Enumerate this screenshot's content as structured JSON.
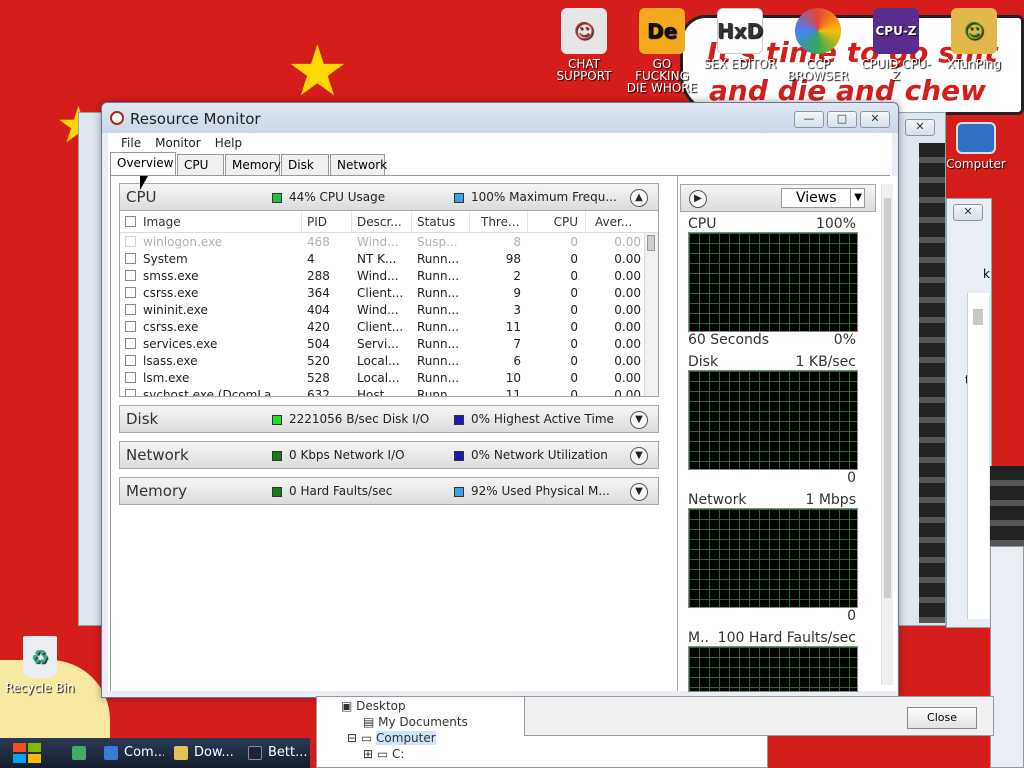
{
  "desktop": {
    "meme_text_1": "It's time to go shit",
    "meme_text_2": "and die and chew",
    "icons": [
      {
        "label": "CHAT SUPPORT",
        "color": "#f0f0f0"
      },
      {
        "label": "GO FUCKING DIE WHORE",
        "color": "#f4a81d"
      },
      {
        "label": "SEX EDITOR",
        "color": "#ffffff"
      },
      {
        "label": "CCP BROWSER",
        "color": "#ea4335"
      },
      {
        "label": "CPUID CPU-Z",
        "color": "#5a2d8c"
      },
      {
        "label": "XTunPing",
        "color": "#e2b84a"
      }
    ],
    "computer_icon_label": "Computer",
    "properties_fragment": "ties",
    "k_fragment": "k",
    "recycle_bin_label": "Recycle Bin"
  },
  "window": {
    "title": "Resource Monitor",
    "minimize": "—",
    "maximize": "□",
    "close": "✕"
  },
  "menu": [
    "File",
    "Monitor",
    "Help"
  ],
  "tabs": [
    "Overview",
    "CPU",
    "Memory",
    "Disk",
    "Network"
  ],
  "sections": {
    "cpu": {
      "title": "CPU",
      "stat1": "44% CPU Usage",
      "stat1_color": "#22c040",
      "stat2": "100% Maximum Frequ...",
      "stat2_color": "#3aa0e8"
    },
    "disk": {
      "title": "Disk",
      "stat1": "2221056 B/sec Disk I/O",
      "stat1_color": "#22dd22",
      "stat2": "0% Highest Active Time",
      "stat2_color": "#1a1ab0"
    },
    "network": {
      "title": "Network",
      "stat1": "0 Kbps Network I/O",
      "stat1_color": "#1a7a1a",
      "stat2": "0% Network Utilization",
      "stat2_color": "#1a1ab0"
    },
    "memory": {
      "title": "Memory",
      "stat1": "0 Hard Faults/sec",
      "stat1_color": "#1a7a1a",
      "stat2": "92% Used Physical M...",
      "stat2_color": "#3aa0e8"
    }
  },
  "process_table": {
    "columns": [
      "Image",
      "PID",
      "Descr...",
      "Status",
      "Thre...",
      "CPU",
      "Aver..."
    ],
    "rows": [
      [
        "winlogon.exe",
        "468",
        "Wind...",
        "Susp...",
        "8",
        "0",
        "0.00"
      ],
      [
        "System",
        "4",
        "NT K...",
        "Runn...",
        "98",
        "0",
        "0.00"
      ],
      [
        "smss.exe",
        "288",
        "Wind...",
        "Runn...",
        "2",
        "0",
        "0.00"
      ],
      [
        "csrss.exe",
        "364",
        "Client...",
        "Runn...",
        "9",
        "0",
        "0.00"
      ],
      [
        "wininit.exe",
        "404",
        "Wind...",
        "Runn...",
        "3",
        "0",
        "0.00"
      ],
      [
        "csrss.exe",
        "420",
        "Client...",
        "Runn...",
        "11",
        "0",
        "0.00"
      ],
      [
        "services.exe",
        "504",
        "Servi...",
        "Runn...",
        "7",
        "0",
        "0.00"
      ],
      [
        "lsass.exe",
        "520",
        "Local...",
        "Runn...",
        "6",
        "0",
        "0.00"
      ],
      [
        "lsm.exe",
        "528",
        "Local...",
        "Runn...",
        "10",
        "0",
        "0.00"
      ],
      [
        "svchost.exe (DcomLa...",
        "632",
        "Host...",
        "Runn...",
        "11",
        "0",
        "0.00"
      ]
    ]
  },
  "graphs": {
    "views_label": "Views",
    "cpu": {
      "name": "CPU",
      "max": "100%",
      "foot_left": "60 Seconds",
      "foot_right": "0%"
    },
    "disk": {
      "name": "Disk",
      "max": "1 KB/sec",
      "foot_right": "0"
    },
    "network": {
      "name": "Network",
      "max": "1 Mbps",
      "foot_right": "0"
    },
    "memory": {
      "name": "M..",
      "max": "100 Hard Faults/sec"
    }
  },
  "taskbar": {
    "items": [
      "Com...",
      "Dow...",
      "Bett..."
    ]
  },
  "explorer": {
    "desktop": "Desktop",
    "my_documents": "My Documents",
    "computer": "Computer",
    "drive": "C:"
  },
  "dialog": {
    "close_label": "Close"
  }
}
